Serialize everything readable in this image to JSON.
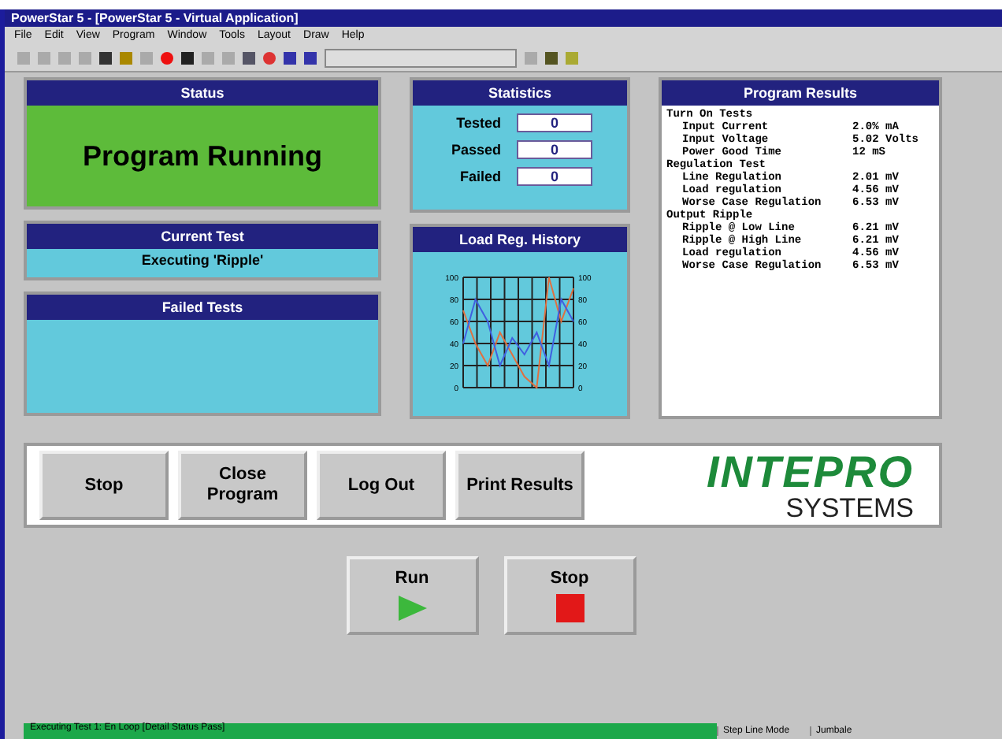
{
  "window": {
    "title": "PowerStar 5 - [PowerStar 5 - Virtual Application]"
  },
  "menu": [
    "File",
    "Edit",
    "View",
    "Program",
    "Window",
    "Tools",
    "Layout",
    "Draw",
    "Help"
  ],
  "status": {
    "title": "Status",
    "text": "Program Running"
  },
  "current_test": {
    "title": "Current Test",
    "text": "Executing 'Ripple'"
  },
  "failed_tests": {
    "title": "Failed Tests"
  },
  "statistics": {
    "title": "Statistics",
    "rows": [
      {
        "label": "Tested",
        "value": "0"
      },
      {
        "label": "Passed",
        "value": "0"
      },
      {
        "label": "Failed",
        "value": "0"
      }
    ]
  },
  "load_history": {
    "title": "Load Reg. History",
    "chart_data": {
      "type": "line",
      "grid": true,
      "yticks": [
        0,
        20,
        40,
        60,
        80,
        100
      ],
      "y2ticks": [
        0,
        20,
        40,
        60,
        80,
        100
      ],
      "ylim": [
        0,
        100
      ],
      "y2lim": [
        0,
        100
      ],
      "series": [
        {
          "color": "#e07040",
          "values": [
            70,
            40,
            20,
            50,
            30,
            10,
            0,
            100,
            60,
            90
          ]
        },
        {
          "color": "#4060e0",
          "values": [
            40,
            80,
            60,
            20,
            45,
            30,
            50,
            20,
            80,
            60
          ]
        }
      ]
    }
  },
  "program_results": {
    "title": "Program Results",
    "lines": [
      {
        "kind": "heading",
        "label": "Turn On Tests"
      },
      {
        "kind": "item",
        "label": "Input Current",
        "value": "2.0% mA"
      },
      {
        "kind": "item",
        "label": "Input Voltage",
        "value": "5.02 Volts"
      },
      {
        "kind": "item",
        "label": "Power Good Time",
        "value": "12 mS"
      },
      {
        "kind": "heading",
        "label": "Regulation Test"
      },
      {
        "kind": "item",
        "label": "Line Regulation",
        "value": "2.01 mV"
      },
      {
        "kind": "item",
        "label": "Load regulation",
        "value": "4.56 mV"
      },
      {
        "kind": "item",
        "label": "Worse Case Regulation",
        "value": "6.53 mV"
      },
      {
        "kind": "heading",
        "label": "Output Ripple"
      },
      {
        "kind": "item",
        "label": "Ripple @ Low Line",
        "value": "6.21 mV"
      },
      {
        "kind": "item",
        "label": "Ripple @ High Line",
        "value": "6.21 mV"
      },
      {
        "kind": "item",
        "label": "Load regulation",
        "value": "4.56 mV"
      },
      {
        "kind": "item",
        "label": "Worse Case Regulation",
        "value": "6.53 mV"
      }
    ]
  },
  "actions": [
    "Stop",
    "Close Program",
    "Log Out",
    "Print Results"
  ],
  "logo": {
    "top": "INTEPRO",
    "bottom": "SYSTEMS"
  },
  "controls": [
    {
      "label": "Run",
      "kind": "run"
    },
    {
      "label": "Stop",
      "kind": "stop"
    }
  ],
  "status_bar": [
    "Executing Test 1: En Loop [Detail Status Pass]",
    "Step Line Mode",
    "Jumbale"
  ]
}
